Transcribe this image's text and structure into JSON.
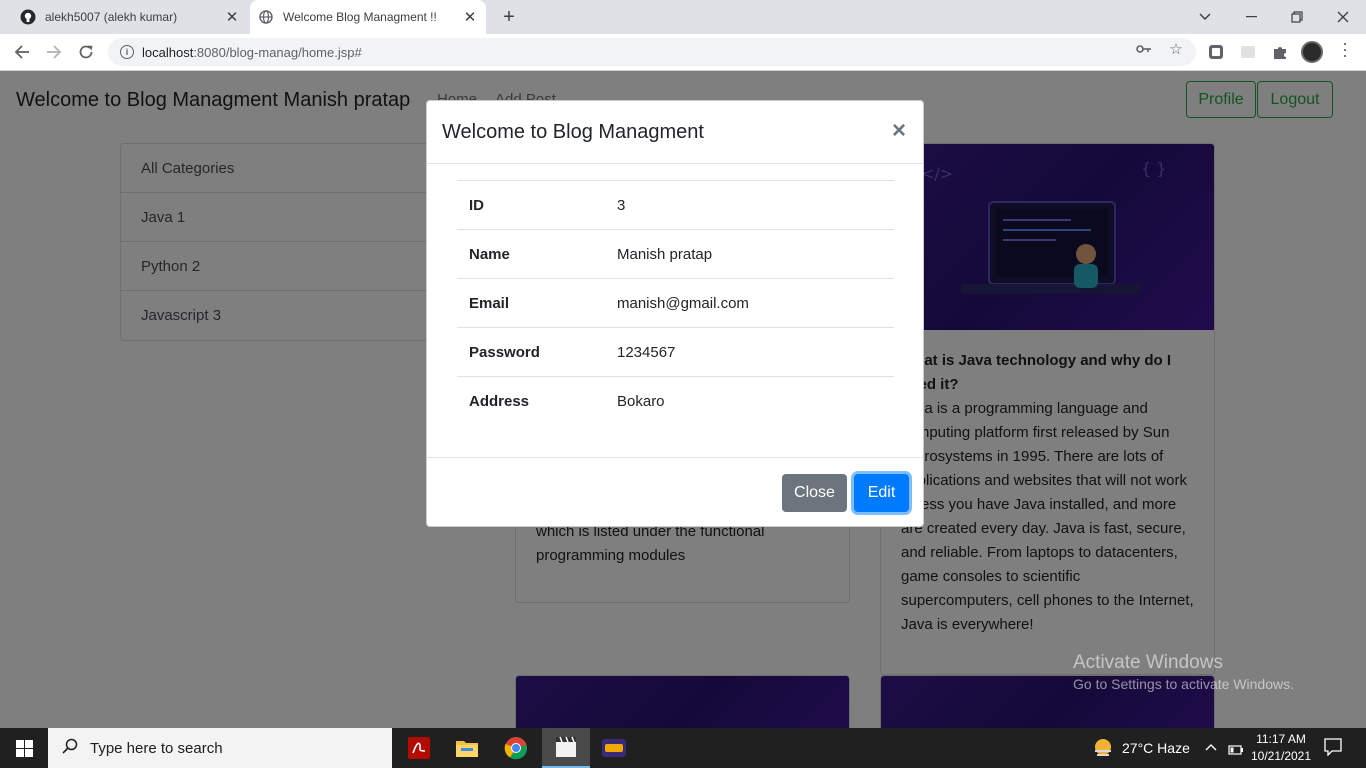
{
  "browser": {
    "tabs": [
      {
        "title": "alekh5007 (alekh kumar)"
      },
      {
        "title": "Welcome Blog Managment !!"
      }
    ],
    "url_host": "localhost",
    "url_rest": ":8080/blog-manag/home.jsp#"
  },
  "navbar": {
    "brand": "Welcome to Blog Managment Manish pratap",
    "links": [
      "Home",
      "Add Post"
    ],
    "profile_label": "Profile",
    "logout_label": "Logout"
  },
  "categories": [
    "All Categories",
    "Java 1",
    "Python 2",
    "Javascript 3"
  ],
  "posts": [
    {
      "text_partial": "which is listed under the functional programming modules"
    },
    {
      "title": "What is Java technology and why do I need it?",
      "body": "Java is a programming language and computing platform first released by Sun Microsystems in 1995. There are lots of applications and websites that will not work unless you have Java installed, and more are created every day. Java is fast, secure, and reliable. From laptops to datacenters, game consoles to scientific supercomputers, cell phones to the Internet, Java is everywhere!"
    }
  ],
  "modal": {
    "title": "Welcome to Blog Managment",
    "close_symbol": "×",
    "rows": [
      {
        "label": "ID",
        "value": "3"
      },
      {
        "label": "Name",
        "value": "Manish pratap"
      },
      {
        "label": "Email",
        "value": "manish@gmail.com"
      },
      {
        "label": "Password",
        "value": "1234567"
      },
      {
        "label": "Address",
        "value": "Bokaro"
      }
    ],
    "close_button": "Close",
    "edit_button": "Edit"
  },
  "watermark": {
    "line1": "Activate Windows",
    "line2": "Go to Settings to activate Windows."
  },
  "taskbar": {
    "search_placeholder": "Type here to search",
    "weather": "27°C  Haze",
    "time": "11:17 AM",
    "date": "10/21/2021"
  }
}
